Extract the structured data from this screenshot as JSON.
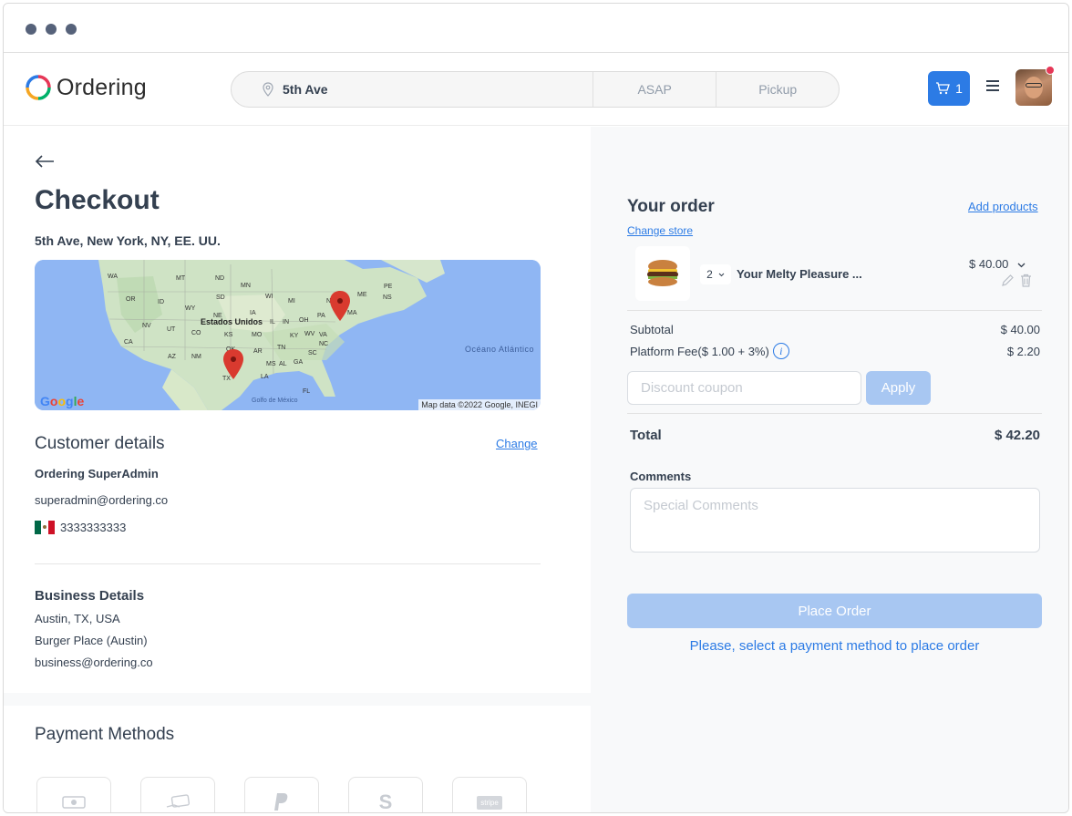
{
  "header": {
    "logo_text": "Ordering",
    "address": "5th Ave",
    "mode_asap": "ASAP",
    "mode_pickup": "Pickup",
    "cart_count": "1"
  },
  "checkout": {
    "title": "Checkout",
    "address": "5th Ave, New York, NY, EE. UU.",
    "map": {
      "attribution": "Map data ©2022 Google, INEGI",
      "logo": "Google",
      "labels": [
        "Estados Unidos",
        "Océano Atlántico",
        "Golfo de México"
      ],
      "state_labels": [
        "WA",
        "MT",
        "ND",
        "MN",
        "OR",
        "ID",
        "SD",
        "WI",
        "MI",
        "WY",
        "NE",
        "IA",
        "NV",
        "UT",
        "CO",
        "KS",
        "MO",
        "IL",
        "IN",
        "OH",
        "PA",
        "NY",
        "CA",
        "OK",
        "AR",
        "TN",
        "KY",
        "WV",
        "VA",
        "AZ",
        "NM",
        "MS",
        "AL",
        "GA",
        "SC",
        "NC",
        "TX",
        "LA",
        "FL",
        "ME",
        "NS",
        "PE",
        "MA"
      ]
    },
    "customer": {
      "title": "Customer details",
      "change_label": "Change",
      "name": "Ordering SuperAdmin",
      "email": "superadmin@ordering.co",
      "phone": "3333333333"
    },
    "business": {
      "title": "Business Details",
      "location": "Austin, TX, USA",
      "name": "Burger Place (Austin)",
      "email": "business@ordering.co"
    },
    "payment": {
      "title": "Payment Methods",
      "methods": [
        "cash-icon",
        "card-icon",
        "paypal-icon",
        "stripe-s-icon",
        "stripe-icon"
      ],
      "stripe_label": "stripe"
    }
  },
  "order": {
    "title": "Your order",
    "add_products": "Add products",
    "change_store": "Change store",
    "product": {
      "quantity": "2",
      "name": "Your Melty Pleasure ...",
      "price": "$ 40.00"
    },
    "subtotal_label": "Subtotal",
    "subtotal_value": "$ 40.00",
    "fee_label": "Platform Fee($ 1.00 + 3%)",
    "fee_value": "$ 2.20",
    "coupon_placeholder": "Discount coupon",
    "apply_label": "Apply",
    "total_label": "Total",
    "total_value": "$ 42.20",
    "comments_label": "Comments",
    "comments_placeholder": "Special Comments",
    "place_order_label": "Place Order",
    "payment_message": "Please, select a payment method to place order"
  },
  "colors": {
    "accent": "#2c7be5",
    "accent_disabled": "#a8c7f2",
    "text": "#344050",
    "panel_bg": "#f8f9fa",
    "notification": "#e63757"
  }
}
